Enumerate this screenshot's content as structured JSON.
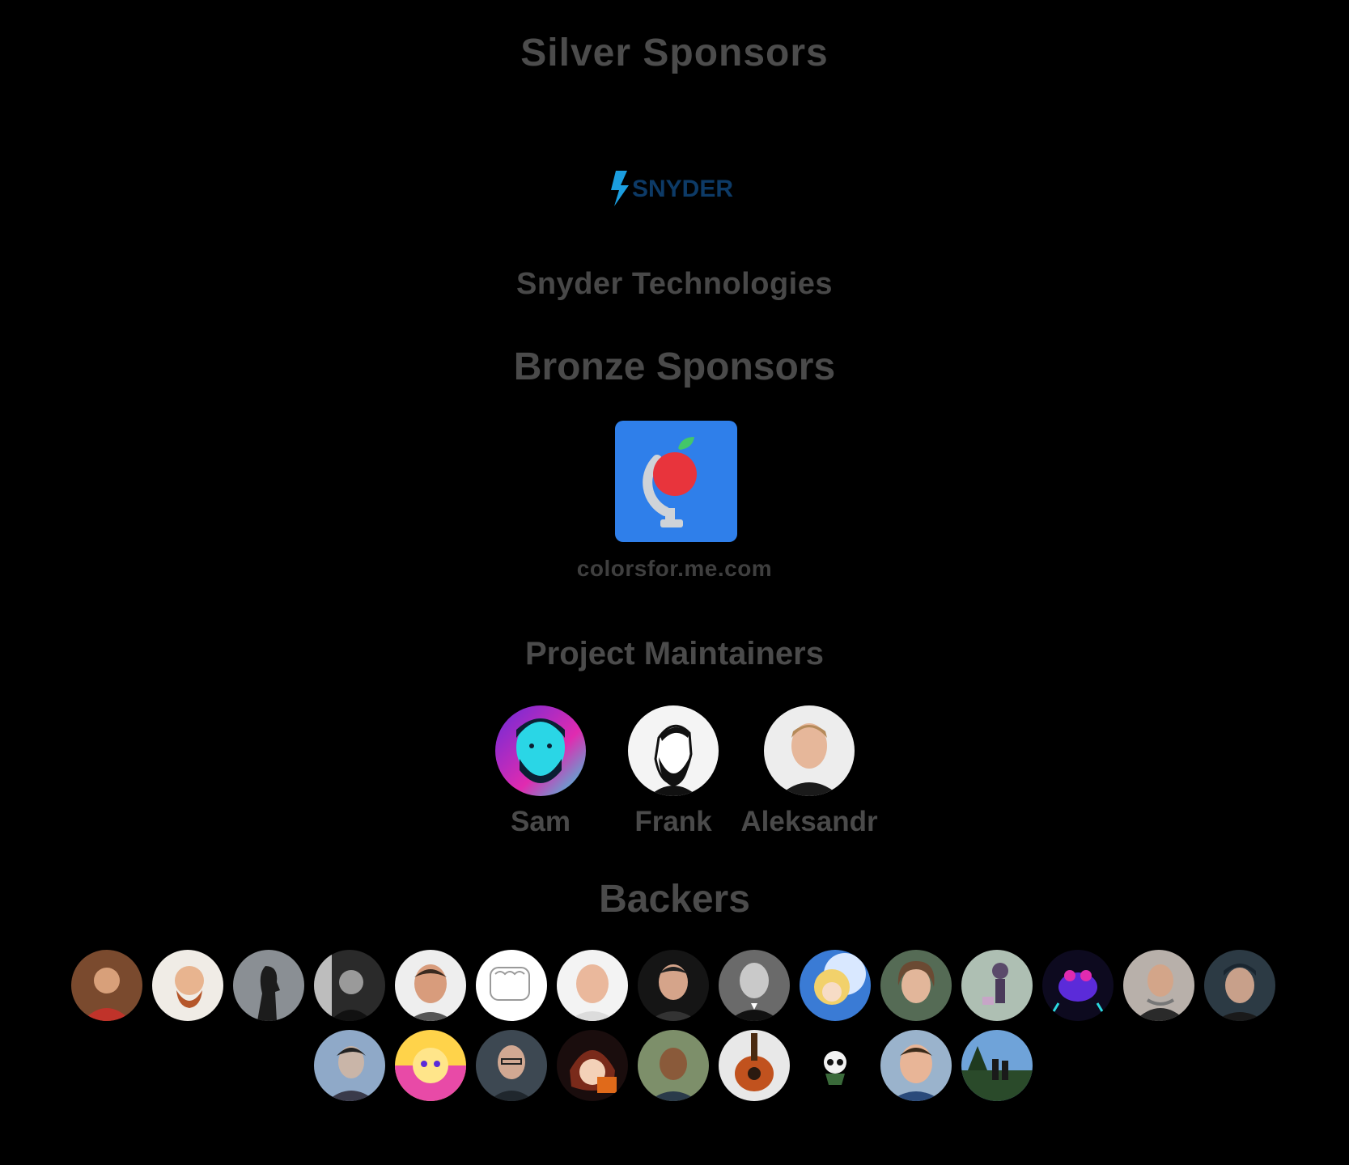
{
  "silver": {
    "heading": "Silver Sponsors",
    "sponsor_logo_text": "SNYDER",
    "sponsor_name": "Snyder Technologies"
  },
  "bronze": {
    "heading": "Bronze Sponsors",
    "sponsor_caption": "colorsfor.me.com"
  },
  "maintainers": {
    "heading": "Project Maintainers",
    "people": [
      {
        "name": "Sam",
        "avatar_icon": "avatar-neon-bearded-man-icon"
      },
      {
        "name": "Frank",
        "avatar_icon": "avatar-line-art-bearded-man-icon"
      },
      {
        "name": "Aleksandr",
        "avatar_icon": "avatar-photo-man-icon"
      }
    ]
  },
  "backers": {
    "heading": "Backers",
    "row1_count": 15,
    "row2_count": 9
  },
  "colors": {
    "background": "#000000",
    "text": "#4b4b4b",
    "bronze_logo_bg": "#2f7fea",
    "bronze_logo_red": "#e8343c",
    "bronze_logo_green": "#43c76a",
    "snyder_blue": "#1b9ee0",
    "snyder_navy": "#0d3a66"
  }
}
